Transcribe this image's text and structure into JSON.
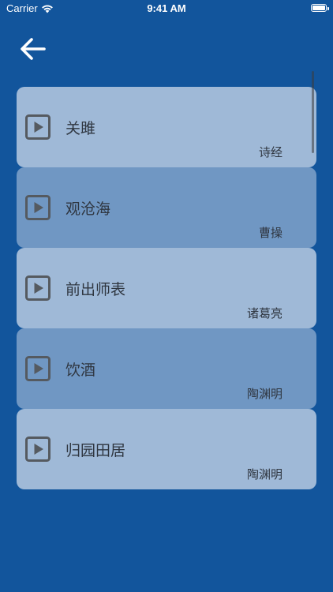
{
  "status_bar": {
    "carrier": "Carrier",
    "time": "9:41 AM",
    "battery_level": 1.0
  },
  "nav": {
    "back_icon": "arrow-left-icon"
  },
  "colors": {
    "background": "#12559c",
    "card_light": "#9fb9d7",
    "card_dark": "#7097c3",
    "text": "#2f3640"
  },
  "poems": [
    {
      "title": "关雎",
      "author": "诗经",
      "icon": "play-icon"
    },
    {
      "title": "观沧海",
      "author": "曹操",
      "icon": "play-icon"
    },
    {
      "title": "前出师表",
      "author": "诸葛亮",
      "icon": "play-icon"
    },
    {
      "title": "饮酒",
      "author": "陶渊明",
      "icon": "play-icon"
    },
    {
      "title": "归园田居",
      "author": "陶渊明",
      "icon": "play-icon"
    }
  ]
}
